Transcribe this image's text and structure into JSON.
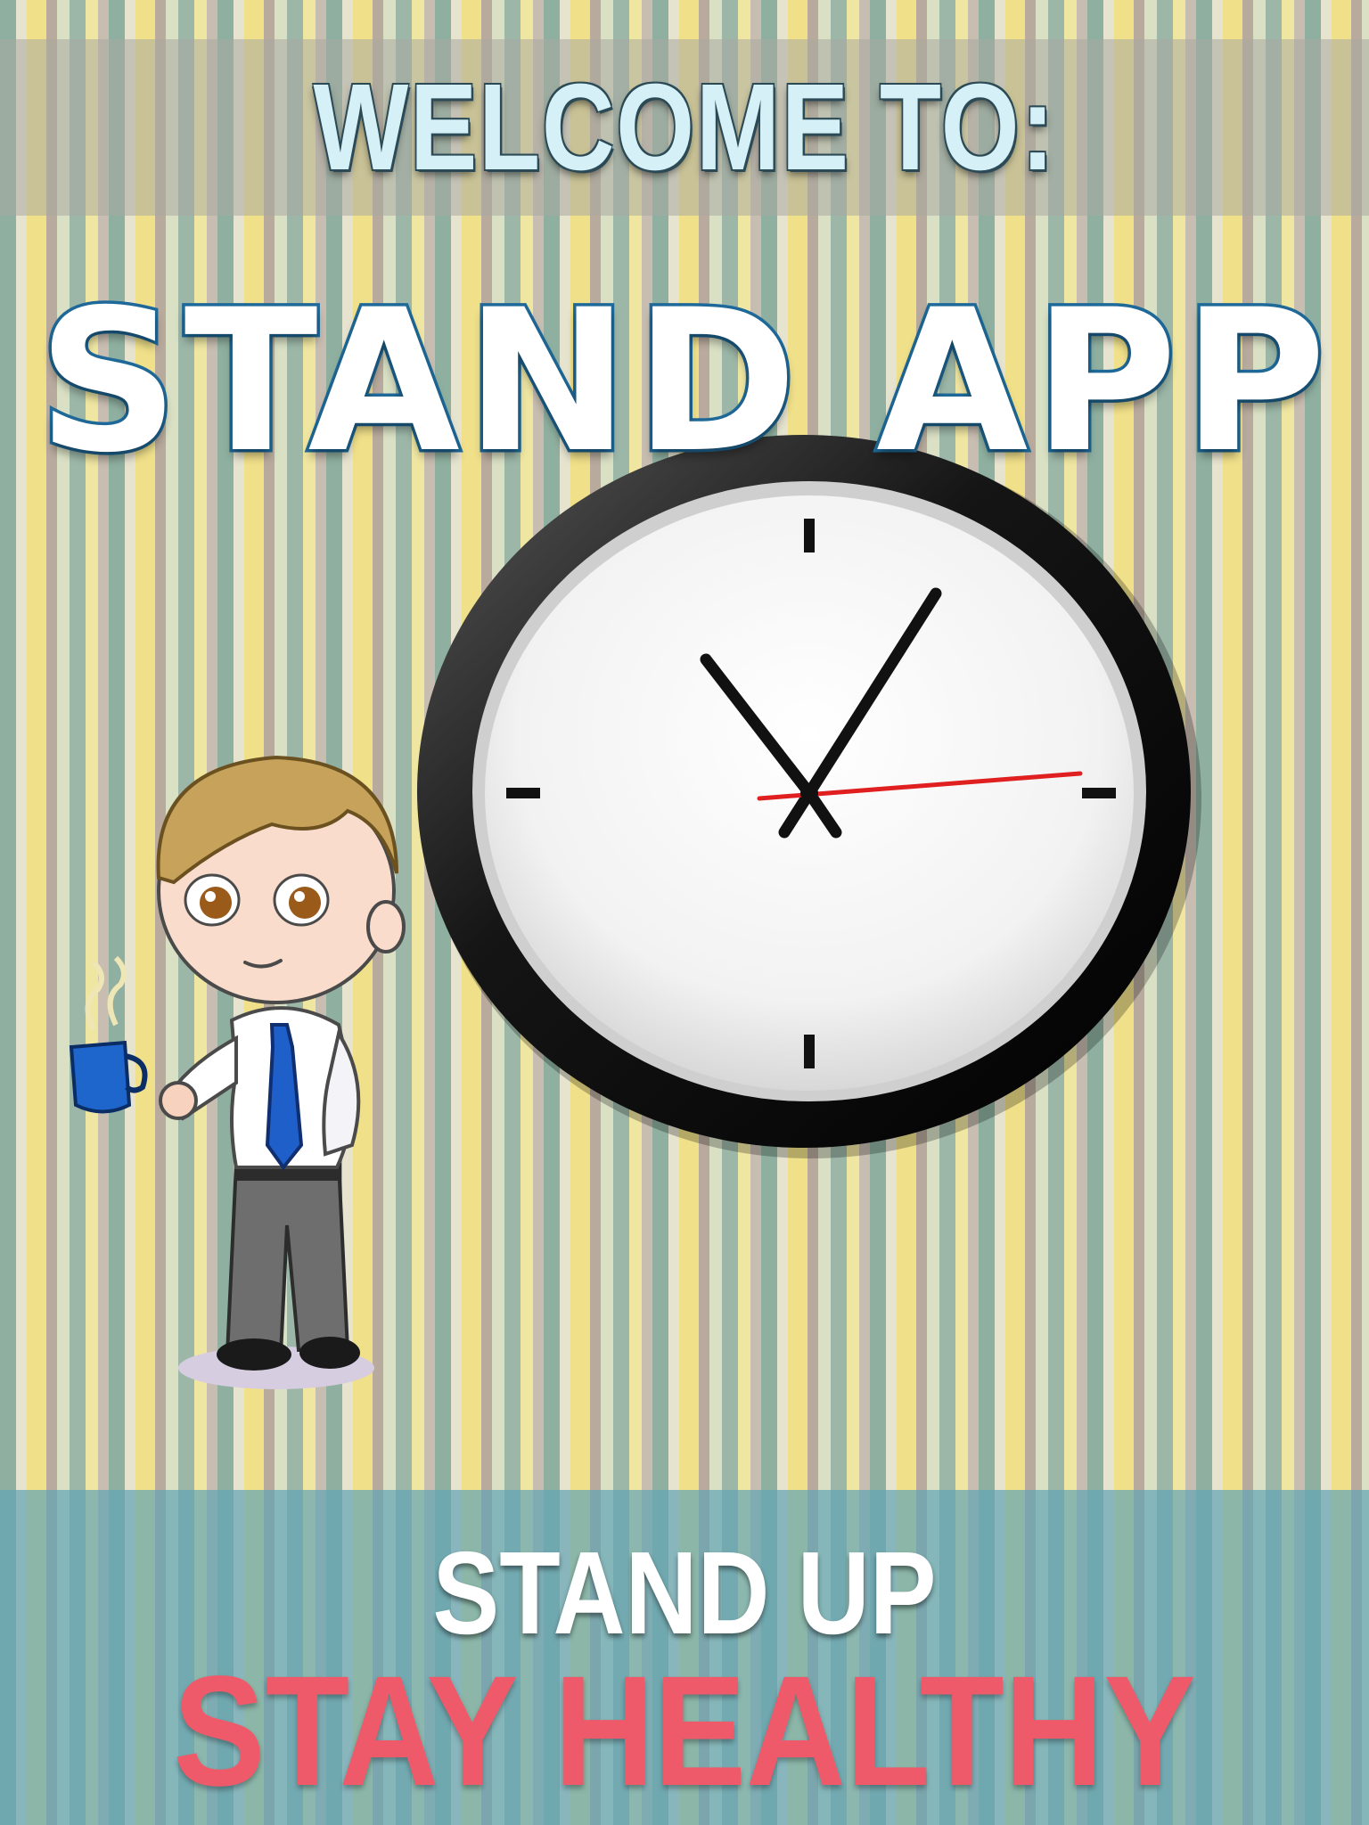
{
  "header": {
    "welcome": "WELCOME TO:"
  },
  "app": {
    "title": "STAND APP"
  },
  "clock": {
    "hour_hand": "11:00",
    "minute_hand": "hand toward 1",
    "second_hand": "near 3"
  },
  "footer": {
    "line1": "STAND UP",
    "line2": "STAY HEALTHY"
  },
  "colors": {
    "title_fill": "#ffffff",
    "title_outline": "#1f6a9a",
    "welcome_fill": "#d6f0f7",
    "tagline_red": "#ef5a6a",
    "footer_banner": "#64a5b4"
  },
  "icons": {
    "clock": "wall-clock-icon",
    "character": "office-worker-illustration",
    "mug": "coffee-mug-icon"
  }
}
